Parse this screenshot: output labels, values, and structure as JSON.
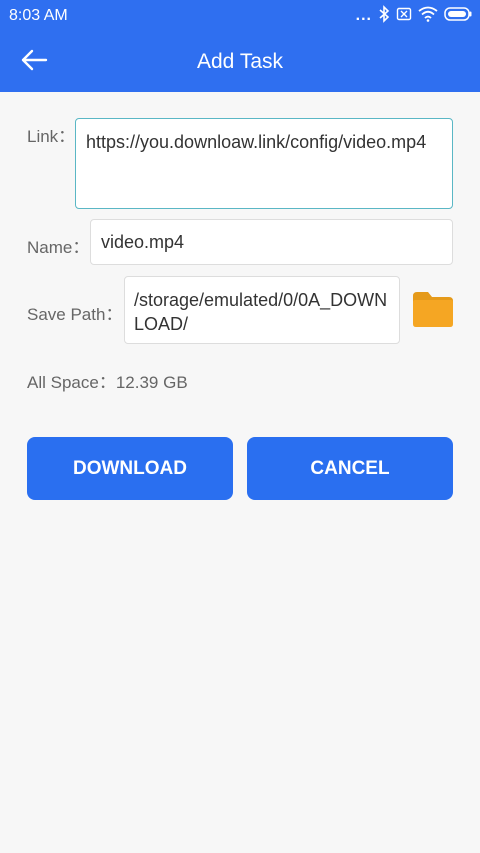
{
  "status_bar": {
    "time": "8:03 AM",
    "more": "..."
  },
  "app_bar": {
    "title": "Add Task"
  },
  "form": {
    "link_label": "Link：",
    "link_value": "https://you.downloaw.link/config/video.mp4",
    "name_label": "Name：",
    "name_value": "video.mp4",
    "save_path_label": "Save Path：",
    "save_path_value": "/storage/emulated/0/0A_DOWNLOAD/"
  },
  "space": {
    "label": "All Space：",
    "value": "12.39 GB"
  },
  "buttons": {
    "download": "DOWNLOAD",
    "cancel": "CANCEL"
  },
  "colors": {
    "primary": "#2f6ff0",
    "accent_folder": "#f5a623",
    "link_border": "#5ab7c5"
  }
}
